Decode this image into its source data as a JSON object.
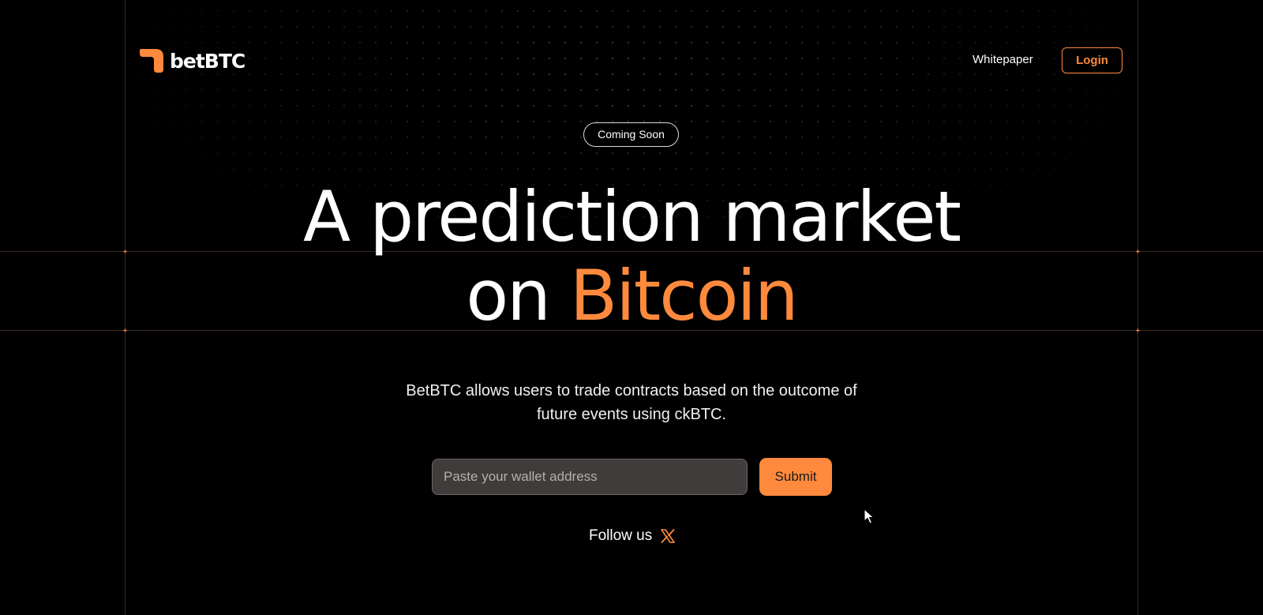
{
  "header": {
    "logo_text": "betBTC",
    "nav": {
      "whitepaper_label": "Whitepaper",
      "login_label": "Login"
    }
  },
  "hero": {
    "badge": "Coming Soon",
    "title_line1": "A prediction market",
    "title_line2_prefix": "on ",
    "title_line2_accent": "Bitcoin",
    "subtitle": "BetBTC allows users to trade contracts based on the outcome of future events using ckBTC."
  },
  "form": {
    "wallet_placeholder": "Paste your wallet address",
    "wallet_value": "",
    "submit_label": "Submit"
  },
  "social": {
    "follow_label": "Follow us",
    "icon": "x-logo-icon"
  },
  "colors": {
    "accent": "#ff8a3d",
    "background": "#000000",
    "input_bg": "#3f3c3b"
  }
}
